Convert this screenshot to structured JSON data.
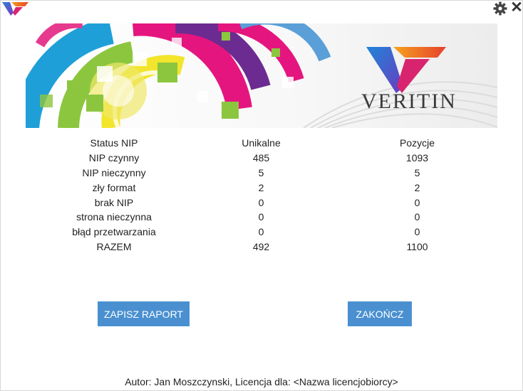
{
  "app": {
    "logo_icon": "veritin-v-logo",
    "settings_icon": "gear-icon",
    "close_icon": "close-icon",
    "close_glyph": "✕"
  },
  "banner": {
    "brand_name": "VERITIN"
  },
  "stats": {
    "headers": [
      "Status NIP",
      "Unikalne",
      "Pozycje"
    ],
    "rows": [
      [
        "NIP czynny",
        "485",
        "1093"
      ],
      [
        "NIP nieczynny",
        "5",
        "5"
      ],
      [
        "zły format",
        "2",
        "2"
      ],
      [
        "brak NIP",
        "0",
        "0"
      ],
      [
        "strona nieczynna",
        "0",
        "0"
      ],
      [
        "błąd przetwarzania",
        "0",
        "0"
      ],
      [
        "RAZEM",
        "492",
        "1100"
      ]
    ]
  },
  "buttons": {
    "save_label": "ZAPISZ RAPORT",
    "end_label": "ZAKOŃCZ",
    "color": "#4a90d0"
  },
  "footer": {
    "text": "Autor: Jan Moszczynski, Licencja dla: <Nazwa licencjobiorcy>"
  }
}
